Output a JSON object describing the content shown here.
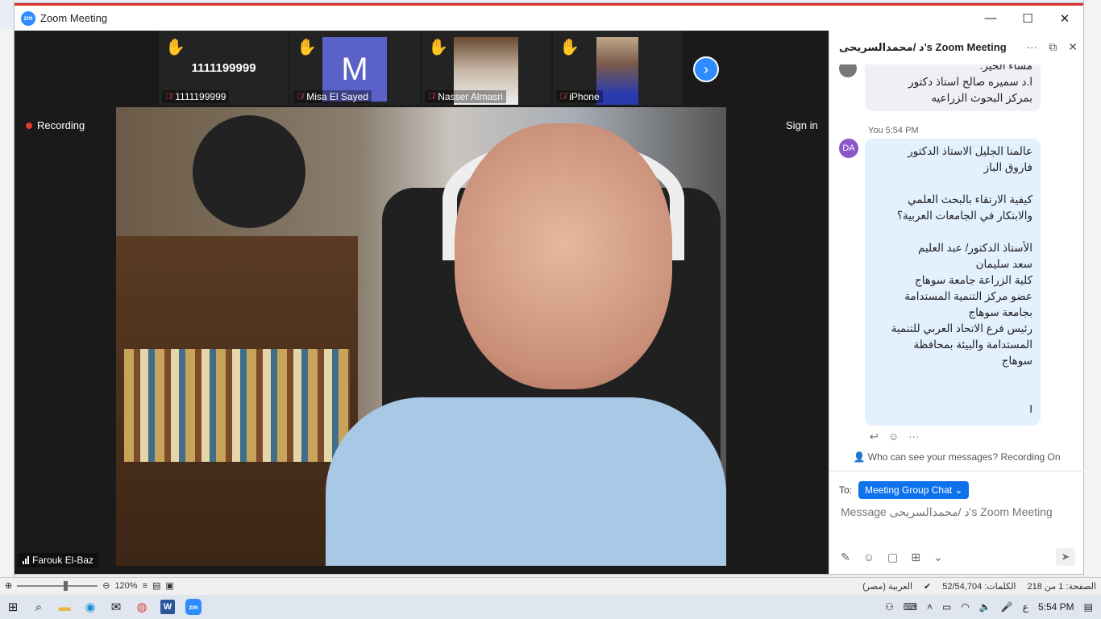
{
  "window": {
    "title": "Zoom Meeting",
    "minimize": "—",
    "maximize": "☐",
    "close": "✕"
  },
  "participants": [
    {
      "display": "1111199999",
      "name": "1111199999",
      "tile": "text"
    },
    {
      "display": "M",
      "name": "Misa El Sayed",
      "tile": "letter"
    },
    {
      "display": "",
      "name": "Nasser Almasri",
      "tile": "photo"
    },
    {
      "display": "",
      "name": "iPhone",
      "tile": "photo"
    }
  ],
  "recording_label": "Recording",
  "signin_label": "Sign in",
  "active_speaker": "Farouk El-Baz",
  "chat": {
    "title": "د /محمدالسريحى's Zoom Meeting",
    "msg1": "مساء الخير.\nا.د سميره صالح استاذ دكتور\nبمركز البحوث الزراعيه",
    "sender": "You",
    "time": "5:54 PM",
    "avatar": "DA",
    "msg2": "عالمنا الجليل الاستاذ الدكتور\nفاروق الباز\n\nكيفية الارتقاء بالبحث العلمي\nوالابتكار في الجامعات العربية؟\n\nالأستاذ الدكتور/ عبد العليم\nسعد سليمان\nكلية الزراعة  جامعة سوهاج\nعضو مركز التنمية المستدامة\nبجامعة سوهاج\nرئيس فرع الاتحاد العربي للتنمية\nالمستدامة والبيئة بمحافظة\nسوهاج\n\n\nI",
    "privacy": "Who can see your messages? Recording On",
    "to_label": "To:",
    "to_target": "Meeting Group Chat ⌄",
    "placeholder": "Message د /محمدالسريحى's Zoom Meeting"
  },
  "word_status": {
    "zoom": "120%",
    "page": "الصفحة: 1 من 218",
    "words": "الكلمات: 52/54,704",
    "language": "العربية (مصر)"
  },
  "taskbar": {
    "time": "5:54 PM",
    "lang": "ع"
  },
  "colors": {
    "accent": "#2d8cff",
    "recording": "#e53935",
    "hand": "#f7c32e"
  }
}
